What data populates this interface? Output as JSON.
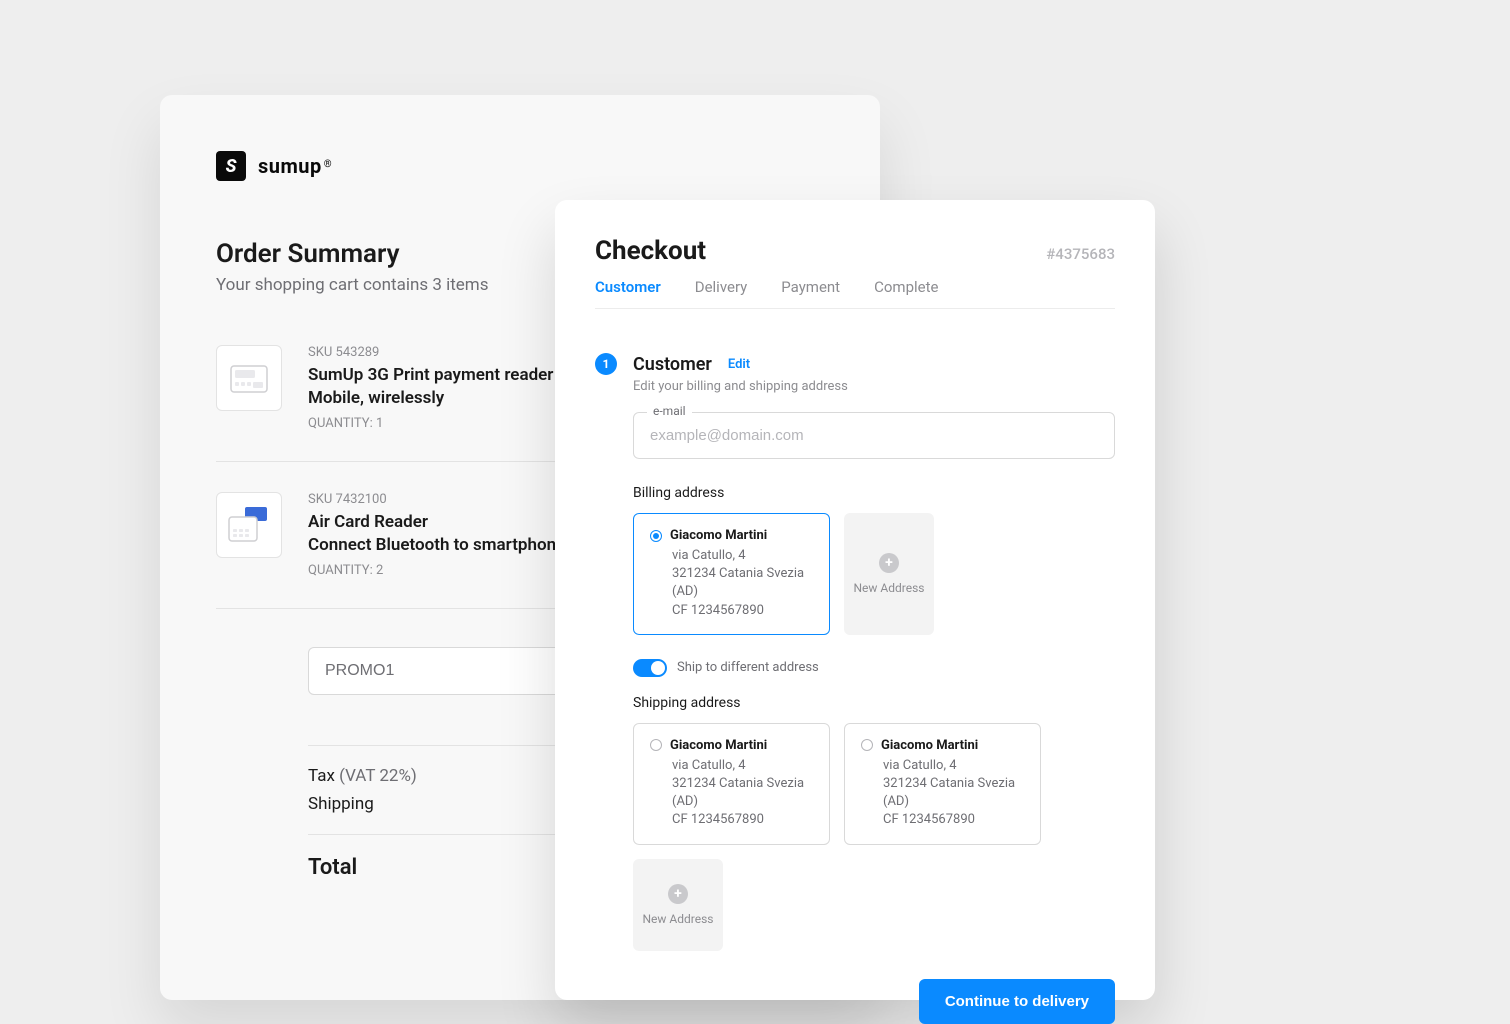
{
  "brand": {
    "name": "sumup",
    "registered": "®"
  },
  "summary": {
    "title": "Order Summary",
    "subtitle": "Your shopping cart contains 3 items",
    "items": [
      {
        "sku_label": "SKU 543289",
        "name_line1": "SumUp 3G Print payment reader",
        "name_line2": "Mobile, wirelessly",
        "qty_label": "QUANTITY: 1"
      },
      {
        "sku_label": "SKU 7432100",
        "name_line1": "Air Card Reader",
        "name_line2": "Connect Bluetooth to smartphone",
        "qty_label": "QUANTITY: 2"
      }
    ],
    "promo_value": "PROMO1",
    "tax_label": "Tax",
    "vat_label": "(VAT 22%)",
    "shipping_label": "Shipping",
    "total_label": "Total"
  },
  "checkout": {
    "title": "Checkout",
    "order_id": "#4375683",
    "tabs": [
      "Customer",
      "Delivery",
      "Payment",
      "Complete"
    ],
    "active_tab_index": 0,
    "step": {
      "number": "1",
      "title": "Customer",
      "edit_label": "Edit",
      "description": "Edit your billing and shipping address"
    },
    "email_field": {
      "label": "e-mail",
      "placeholder": "example@domain.com"
    },
    "billing_section_label": "Billing address",
    "shipping_section_label": "Shipping address",
    "addresses": {
      "billing": [
        {
          "name": "Giacomo Martini",
          "line1": "via Catullo, 4",
          "line2": "321234 Catania Svezia (AD)",
          "line3": "CF 1234567890",
          "selected": true
        }
      ],
      "shipping": [
        {
          "name": "Giacomo Martini",
          "line1": "via Catullo, 4",
          "line2": "321234 Catania Svezia (AD)",
          "line3": "CF 1234567890",
          "selected": false
        },
        {
          "name": "Giacomo Martini",
          "line1": "via Catullo, 4",
          "line2": "321234 Catania Svezia (AD)",
          "line3": "CF 1234567890",
          "selected": false
        }
      ]
    },
    "new_address_label": "New Address",
    "ship_diff_label": "Ship to different address",
    "cta_label": "Continue to delivery"
  }
}
